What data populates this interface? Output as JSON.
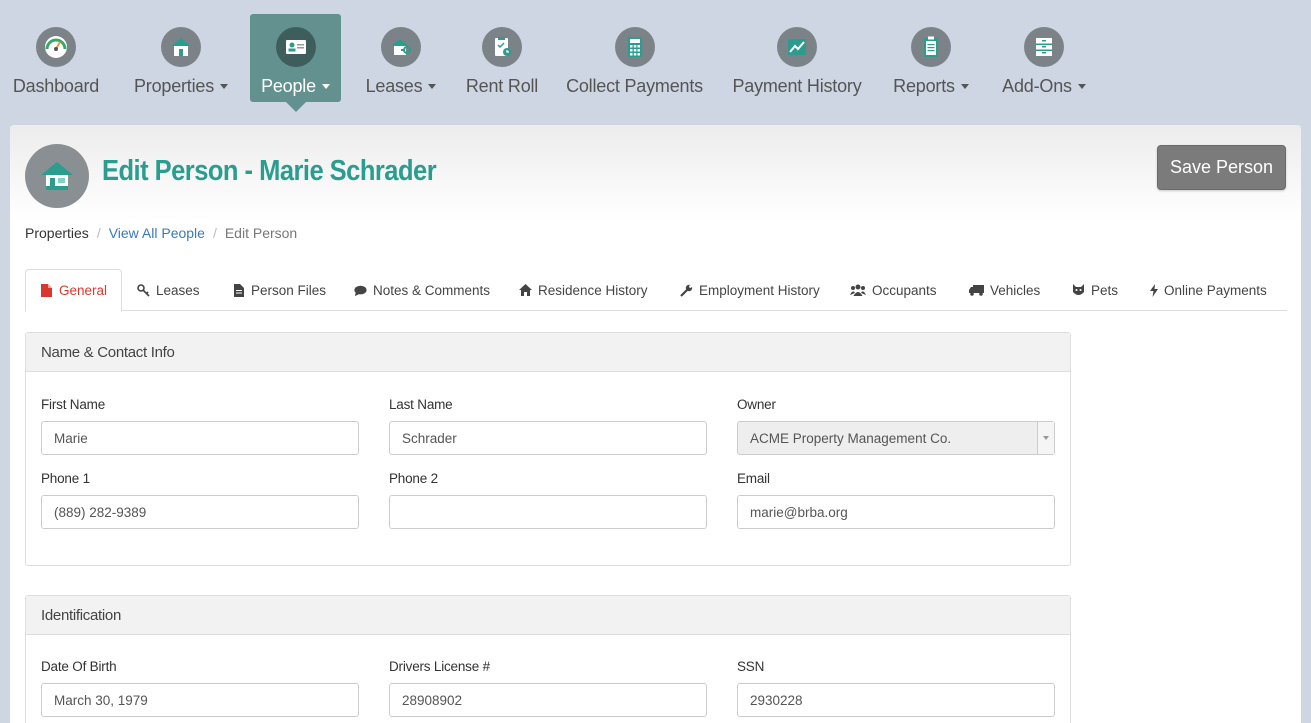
{
  "nav": {
    "items": [
      {
        "label": "Dashboard",
        "icon": "gauge-icon"
      },
      {
        "label": "Properties",
        "icon": "house-icon",
        "dropdown": true
      },
      {
        "label": "People",
        "icon": "person-card-icon",
        "dropdown": true,
        "active": true
      },
      {
        "label": "Leases",
        "icon": "house-key-icon",
        "dropdown": true
      },
      {
        "label": "Rent Roll",
        "icon": "clipboard-clock-icon"
      },
      {
        "label": "Collect Payments",
        "icon": "calculator-icon"
      },
      {
        "label": "Payment History",
        "icon": "line-chart-icon"
      },
      {
        "label": "Reports",
        "icon": "clipboard-icon",
        "dropdown": true
      },
      {
        "label": "Add-Ons",
        "icon": "cabinet-icon",
        "dropdown": true
      }
    ]
  },
  "header": {
    "title": "Edit Person - Marie Schrader",
    "save_label": "Save Person"
  },
  "breadcrumb": {
    "items": [
      "Properties",
      "View All People",
      "Edit Person"
    ]
  },
  "tabs": [
    {
      "label": "General",
      "icon": "file-icon",
      "active": true
    },
    {
      "label": "Leases",
      "icon": "key-icon"
    },
    {
      "label": "Person Files",
      "icon": "document-icon"
    },
    {
      "label": "Notes & Comments",
      "icon": "comment-icon"
    },
    {
      "label": "Residence History",
      "icon": "home-icon"
    },
    {
      "label": "Employment History",
      "icon": "wrench-icon"
    },
    {
      "label": "Occupants",
      "icon": "users-icon"
    },
    {
      "label": "Vehicles",
      "icon": "truck-icon"
    },
    {
      "label": "Pets",
      "icon": "pet-icon"
    },
    {
      "label": "Online Payments",
      "icon": "bolt-icon"
    }
  ],
  "contact": {
    "title": "Name & Contact Info",
    "first_name": {
      "label": "First Name",
      "value": "Marie"
    },
    "last_name": {
      "label": "Last Name",
      "value": "Schrader"
    },
    "owner": {
      "label": "Owner",
      "value": "ACME Property Management Co."
    },
    "phone1": {
      "label": "Phone 1",
      "value": "(889) 282-9389"
    },
    "phone2": {
      "label": "Phone 2",
      "value": ""
    },
    "email": {
      "label": "Email",
      "value": "marie@brba.org"
    }
  },
  "identification": {
    "title": "Identification",
    "dob": {
      "label": "Date Of Birth",
      "value": "March 30, 1979"
    },
    "license": {
      "label": "Drivers License #",
      "value": "28908902"
    },
    "ssn": {
      "label": "SSN",
      "value": "2930228"
    }
  },
  "colors": {
    "accent": "#2a9d8f",
    "nav_active": "#62918f",
    "tab_active": "#d9382e",
    "link": "#3a7ab8"
  }
}
